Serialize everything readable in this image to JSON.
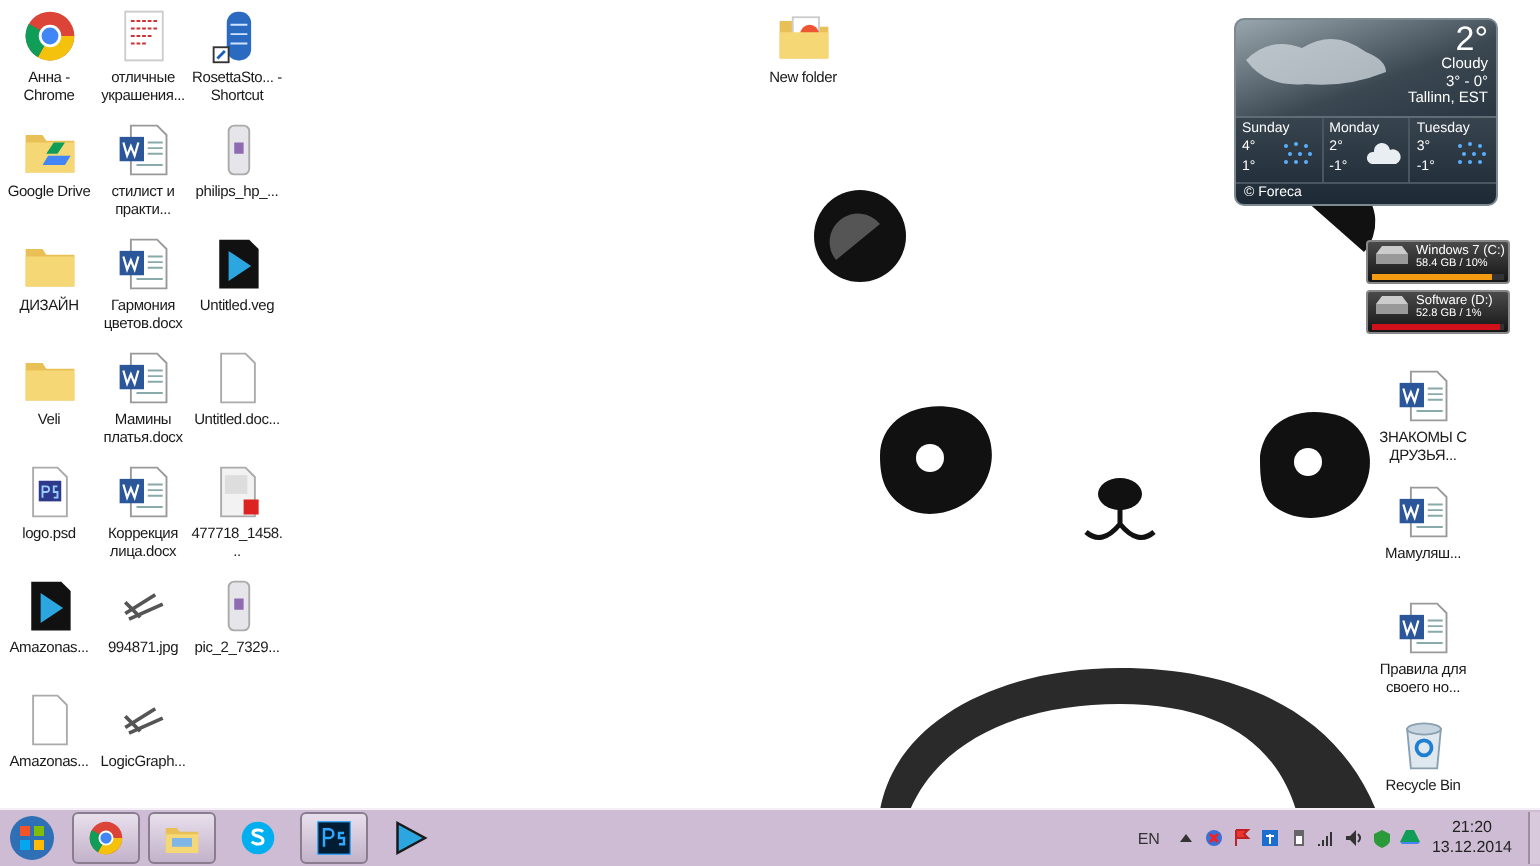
{
  "desktop": {
    "left_icons": [
      {
        "label": "Анна - Chrome",
        "kind": "chrome"
      },
      {
        "label": "Google Drive",
        "kind": "drive-folder"
      },
      {
        "label": "ДИЗАЙН",
        "kind": "folder"
      },
      {
        "label": "Veli",
        "kind": "folder"
      },
      {
        "label": "logo.psd",
        "kind": "psd"
      },
      {
        "label": "Amazonas...",
        "kind": "video"
      },
      {
        "label": "Amazonas...",
        "kind": "blank"
      },
      {
        "label": "отличные украшения...",
        "kind": "notes"
      },
      {
        "label": "стилист и практи...",
        "kind": "word"
      },
      {
        "label": "Гармония цветов.docx",
        "kind": "word"
      },
      {
        "label": "Мамины платья.docx",
        "kind": "word"
      },
      {
        "label": "Коррекция лица.docx",
        "kind": "word"
      },
      {
        "label": "994871.jpg",
        "kind": "tools"
      },
      {
        "label": "LogicGraph...",
        "kind": "tools"
      },
      {
        "label": "RosettaSto... - Shortcut",
        "kind": "rosetta"
      },
      {
        "label": "philips_hp_...",
        "kind": "device"
      },
      {
        "label": "Untitled.veg",
        "kind": "video"
      },
      {
        "label": "Untitled.doc...",
        "kind": "blank"
      },
      {
        "label": "477718_1458...",
        "kind": "pdf"
      },
      {
        "label": "pic_2_7329...",
        "kind": "device"
      }
    ],
    "center_icons": [
      {
        "label": "New folder",
        "kind": "folder-image"
      }
    ],
    "right_icons": [
      {
        "label": "ЗНАКОМЫ С ДРУЗЬЯ...",
        "kind": "word"
      },
      {
        "label": "Мамуляш...",
        "kind": "word"
      },
      {
        "label": "Правила для своего но...",
        "kind": "word"
      },
      {
        "label": "Recycle Bin",
        "kind": "recycle"
      }
    ]
  },
  "weather_gadget": {
    "temperature": "2°",
    "condition": "Cloudy",
    "range": "3° - 0°",
    "location": "Tallinn, EST",
    "forecast": [
      {
        "day": "Sunday",
        "high": "4°",
        "low": "1°",
        "kind": "rain"
      },
      {
        "day": "Monday",
        "high": "2°",
        "low": "-1°",
        "kind": "cloud"
      },
      {
        "day": "Tuesday",
        "high": "3°",
        "low": "-1°",
        "kind": "rain"
      }
    ],
    "credit": "© Foreca"
  },
  "drive_gadget": [
    {
      "name": "Windows 7 (C:)",
      "usage": "58.4 GB / 10%",
      "level": 0.9,
      "color": "#f39c12"
    },
    {
      "name": "Software (D:)",
      "usage": "52.8 GB / 1%",
      "level": 0.97,
      "color": "#d0101a"
    }
  ],
  "taskbar": {
    "apps": [
      {
        "kind": "chrome",
        "running": true
      },
      {
        "kind": "explorer",
        "running": true
      },
      {
        "kind": "skype",
        "running": false
      },
      {
        "kind": "photoshop",
        "running": true
      },
      {
        "kind": "player",
        "running": false
      }
    ],
    "language": "EN",
    "time": "21:20",
    "date": "13.12.2014"
  }
}
